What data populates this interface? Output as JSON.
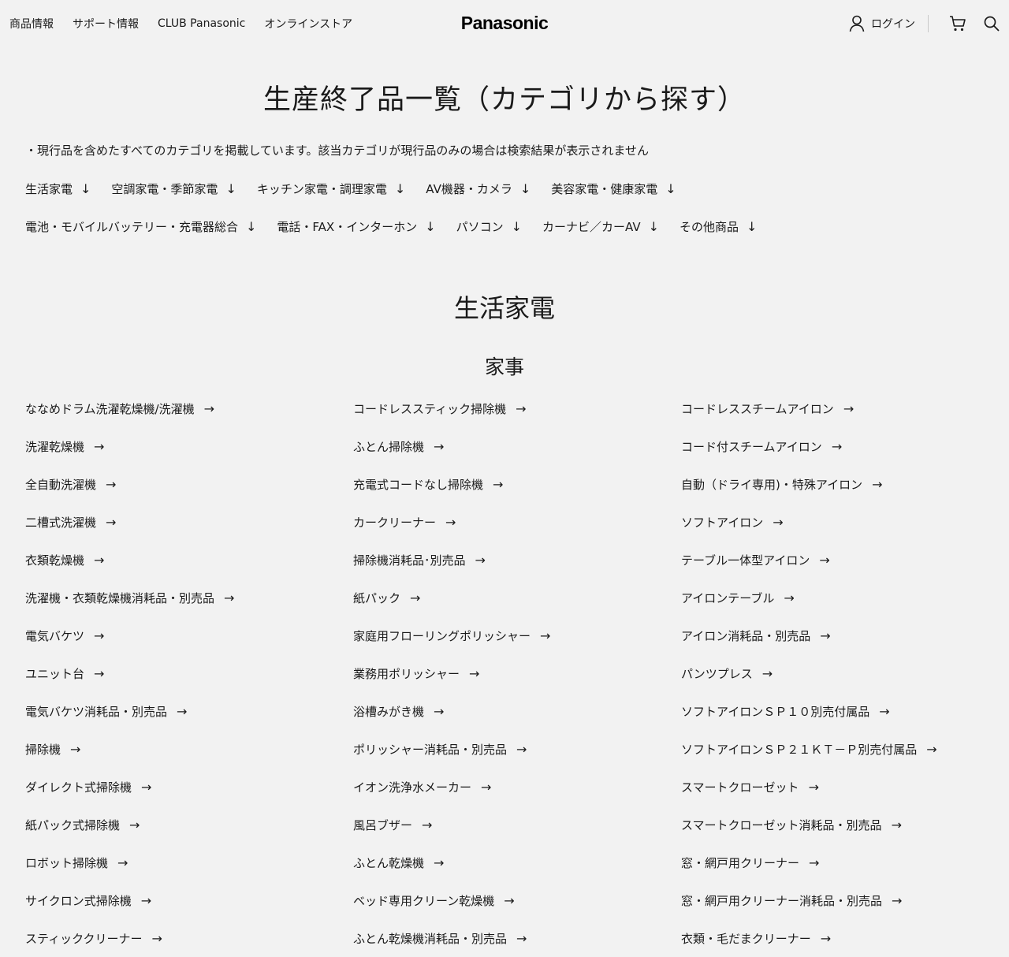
{
  "header": {
    "nav": [
      "商品情報",
      "サポート情報",
      "CLUB Panasonic",
      "オンラインストア"
    ],
    "logo": "Panasonic",
    "login_label": "ログイン"
  },
  "page_title": "生産終了品一覧（カテゴリから探す）",
  "note": "・現行品を含めたすべてのカテゴリを掲載しています。該当カテゴリが現行品のみの場合は検索結果が表示されません",
  "anchors_row1": [
    "生活家電",
    "空調家電・季節家電",
    "キッチン家電・調理家電",
    "AV機器・カメラ",
    "美容家電・健康家電"
  ],
  "anchors_row2": [
    "電池・モバイルバッテリー・充電器総合",
    "電話・FAX・インターホン",
    "パソコン",
    "カーナビ／カーAV",
    "その他商品"
  ],
  "section_title": "生活家電",
  "subsection_title": "家事",
  "columns": [
    [
      "ななめドラム洗濯乾燥機/洗濯機",
      "洗濯乾燥機",
      "全自動洗濯機",
      "二槽式洗濯機",
      "衣類乾燥機",
      "洗濯機・衣類乾燥機消耗品・別売品",
      "電気バケツ",
      "ユニット台",
      "電気バケツ消耗品・別売品",
      "掃除機",
      "ダイレクト式掃除機",
      "紙パック式掃除機",
      "ロボット掃除機",
      "サイクロン式掃除機",
      "スティッククリーナー"
    ],
    [
      "コードレススティック掃除機",
      "ふとん掃除機",
      "充電式コードなし掃除機",
      "カークリーナー",
      "掃除機消耗品･別売品",
      "紙パック",
      "家庭用フローリングポリッシャー",
      "業務用ポリッシャー",
      "浴槽みがき機",
      "ポリッシャー消耗品・別売品",
      "イオン洗浄水メーカー",
      "風呂ブザー",
      "ふとん乾燥機",
      "ベッド専用クリーン乾燥機",
      "ふとん乾燥機消耗品・別売品"
    ],
    [
      "コードレススチームアイロン",
      "コード付スチームアイロン",
      "自動（ドライ専用)・特殊アイロン",
      "ソフトアイロン",
      "テーブル一体型アイロン",
      "アイロンテーブル",
      "アイロン消耗品・別売品",
      "パンツプレス",
      "ソフトアイロンＳＰ１０別売付属品",
      "ソフトアイロンＳＰ２１ＫＴ－Ｐ別売付属品",
      "スマートクローゼット",
      "スマートクローゼット消耗品・別売品",
      "窓・網戸用クリーナー",
      "窓・網戸用クリーナー消耗品・別売品",
      "衣類・毛だまクリーナー"
    ]
  ],
  "icons": {
    "down_arrow": "↓",
    "right_arrow": "→",
    "user": "user-icon",
    "cart": "cart-icon",
    "search": "search-icon"
  }
}
